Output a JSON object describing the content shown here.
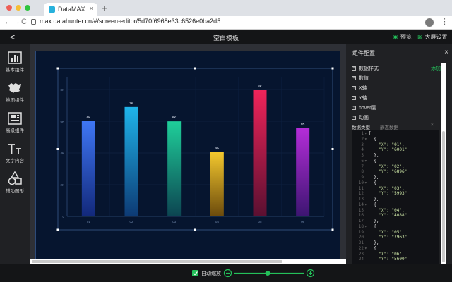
{
  "browser": {
    "tab_title": "DataMAX",
    "tab_close": "×",
    "new_tab": "+",
    "url": "max.datahunter.cn/#/screen-editor/5d70f6968e33c6526e0ba2d5",
    "nav_back": "←",
    "nav_forward": "→",
    "nav_reload": "C",
    "menu": "⋮"
  },
  "topbar": {
    "back": "<",
    "title": "空白模板",
    "preview_label": "预览",
    "screen_settings_label": "大屏设置"
  },
  "leftbar": {
    "items": [
      {
        "label": "基本组件",
        "icon": "chart-icon"
      },
      {
        "label": "地图组件",
        "icon": "map-icon"
      },
      {
        "label": "高级组件",
        "icon": "advanced-icon"
      },
      {
        "label": "文字内容",
        "icon": "text-icon"
      },
      {
        "label": "辅助图形",
        "icon": "shapes-icon"
      }
    ]
  },
  "chart_data": {
    "type": "bar",
    "categories": [
      "01",
      "02",
      "03",
      "04",
      "05",
      "06"
    ],
    "values": [
      6001,
      6896,
      5993,
      4088,
      7963,
      5600
    ],
    "data_labels": [
      "6K",
      "7K",
      "6K",
      "4K",
      "8K",
      "6K"
    ],
    "y_ticks": [
      "0",
      "2K",
      "4K",
      "6K",
      "8K"
    ],
    "ylim": [
      0,
      8800
    ],
    "grid": true,
    "title": "",
    "xlabel": "",
    "ylabel": "",
    "colors": [
      [
        "#3f77f5",
        "#12287a"
      ],
      [
        "#1fb4ea",
        "#0d3a74"
      ],
      [
        "#1fcf9a",
        "#0c4451"
      ],
      [
        "#f5c92e",
        "#6b4a0c"
      ],
      [
        "#ef245a",
        "#5b1031"
      ],
      [
        "#b42dd9",
        "#3c1571"
      ]
    ]
  },
  "rightpanel": {
    "title": "组件配置",
    "close": "×",
    "add_label": "添加",
    "sections": [
      "数据样式",
      "数值",
      "X轴",
      "Y轴",
      "hover层",
      "动画"
    ],
    "data_type_label": "数据类型",
    "data_type_value": "静态数据",
    "code_lines": [
      {
        "n": "1",
        "f": "▾",
        "t": "["
      },
      {
        "n": "2",
        "f": "▾",
        "t": "  {"
      },
      {
        "n": "3",
        "f": "",
        "t": "    \"X\": \"01\","
      },
      {
        "n": "4",
        "f": "",
        "t": "    \"Y\": \"6001\""
      },
      {
        "n": "5",
        "f": "",
        "t": "  },"
      },
      {
        "n": "6",
        "f": "▾",
        "t": "  {"
      },
      {
        "n": "7",
        "f": "",
        "t": "    \"X\": \"02\","
      },
      {
        "n": "8",
        "f": "",
        "t": "    \"Y\": \"6896\""
      },
      {
        "n": "9",
        "f": "",
        "t": "  },"
      },
      {
        "n": "10",
        "f": "▾",
        "t": "  {"
      },
      {
        "n": "11",
        "f": "",
        "t": "    \"X\": \"03\","
      },
      {
        "n": "12",
        "f": "",
        "t": "    \"Y\": \"5993\""
      },
      {
        "n": "13",
        "f": "",
        "t": "  },"
      },
      {
        "n": "14",
        "f": "▾",
        "t": "  {"
      },
      {
        "n": "15",
        "f": "",
        "t": "    \"X\": \"04\","
      },
      {
        "n": "16",
        "f": "",
        "t": "    \"Y\": \"4088\""
      },
      {
        "n": "17",
        "f": "",
        "t": "  },"
      },
      {
        "n": "18",
        "f": "▾",
        "t": "  {"
      },
      {
        "n": "19",
        "f": "",
        "t": "    \"X\": \"05\","
      },
      {
        "n": "20",
        "f": "",
        "t": "    \"Y\": \"7963\""
      },
      {
        "n": "21",
        "f": "",
        "t": "  },"
      },
      {
        "n": "22",
        "f": "▾",
        "t": "  {"
      },
      {
        "n": "23",
        "f": "",
        "t": "    \"X\": \"06\","
      },
      {
        "n": "24",
        "f": "",
        "t": "    \"Y\": \"5600\""
      }
    ]
  },
  "bottombar": {
    "auto_zoom_label": "自动缩放",
    "zoom_level": 0.48
  }
}
